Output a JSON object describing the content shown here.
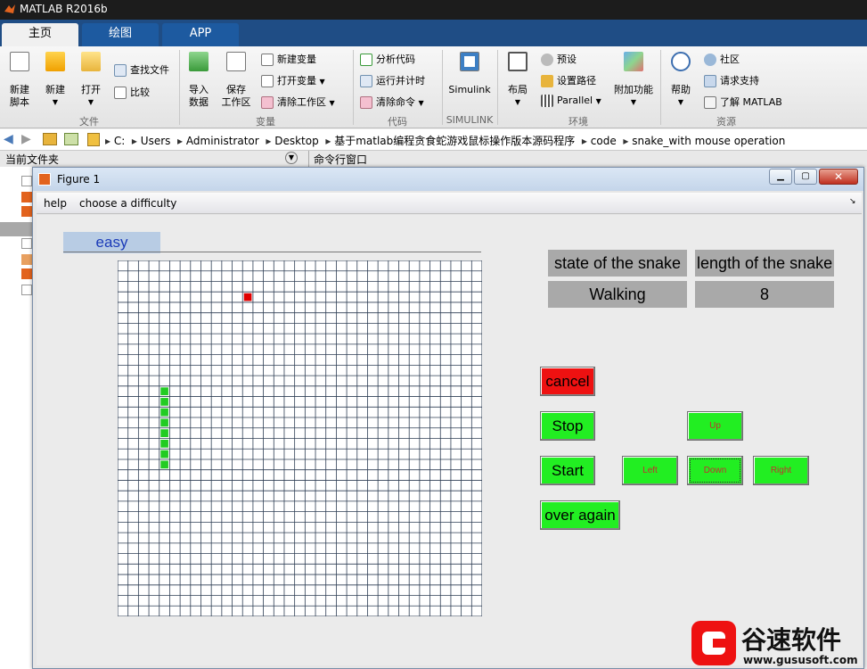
{
  "window": {
    "title": "MATLAB R2016b"
  },
  "tabs": [
    {
      "label": "主页"
    },
    {
      "label": "绘图"
    },
    {
      "label": "APP"
    }
  ],
  "ribbon": {
    "file": {
      "new_script": "新建\n脚本",
      "new": "新建",
      "open": "打开",
      "find_files": "查找文件",
      "compare": "比较",
      "group": "文件"
    },
    "variable": {
      "import": "导入\n数据",
      "save_ws": "保存\n工作区",
      "new_var": "新建变量",
      "open_var": "打开变量",
      "clear_ws": "清除工作区",
      "group": "变量"
    },
    "code": {
      "analyze": "分析代码",
      "run_time": "运行并计时",
      "clear_cmd": "清除命令",
      "group": "代码"
    },
    "simulink": {
      "label": "Simulink",
      "group": "SIMULINK"
    },
    "env": {
      "layout": "布局",
      "prefs": "预设",
      "set_path": "设置路径",
      "parallel": "Parallel",
      "addons": "附加功能",
      "group": "环境"
    },
    "resources": {
      "help": "帮助",
      "community": "社区",
      "support": "请求支持",
      "learn": "了解 MATLAB",
      "group": "资源"
    }
  },
  "address": {
    "path": [
      "C:",
      "Users",
      "Administrator",
      "Desktop",
      "基于matlab编程贪食蛇游戏鼠标操作版本源码程序",
      "code",
      "snake_with mouse operation"
    ]
  },
  "panels": {
    "current_folder": "当前文件夹",
    "command_window": "命令行窗口"
  },
  "figure": {
    "title": "Figure 1",
    "menu": [
      "help",
      "choose a difficulty"
    ],
    "difficulty": "easy",
    "state_header": "state of the snake",
    "length_header": "length of the snake",
    "state_value": "Walking",
    "length_value": "8",
    "buttons": {
      "cancel": "cancel",
      "stop": "Stop",
      "start": "Start",
      "over_again": "over again",
      "up": "Up",
      "left": "Left",
      "down": "Down",
      "right": "Right"
    },
    "board": {
      "cols": 35,
      "rows": 34,
      "food": [
        12,
        3
      ],
      "snake": [
        [
          4,
          12
        ],
        [
          4,
          13
        ],
        [
          4,
          14
        ],
        [
          4,
          15
        ],
        [
          4,
          16
        ],
        [
          4,
          17
        ],
        [
          4,
          18
        ],
        [
          4,
          19
        ]
      ],
      "food_color": "#e00000",
      "snake_color": "#22cc22",
      "grid_color": "#2f3f55"
    }
  },
  "watermark": {
    "brand": "谷速软件",
    "url": "www.gususoft.com"
  },
  "colors": {
    "green_button": "#22ee22",
    "red_button": "#ee1111",
    "gray_cell": "#a9a9a9"
  }
}
